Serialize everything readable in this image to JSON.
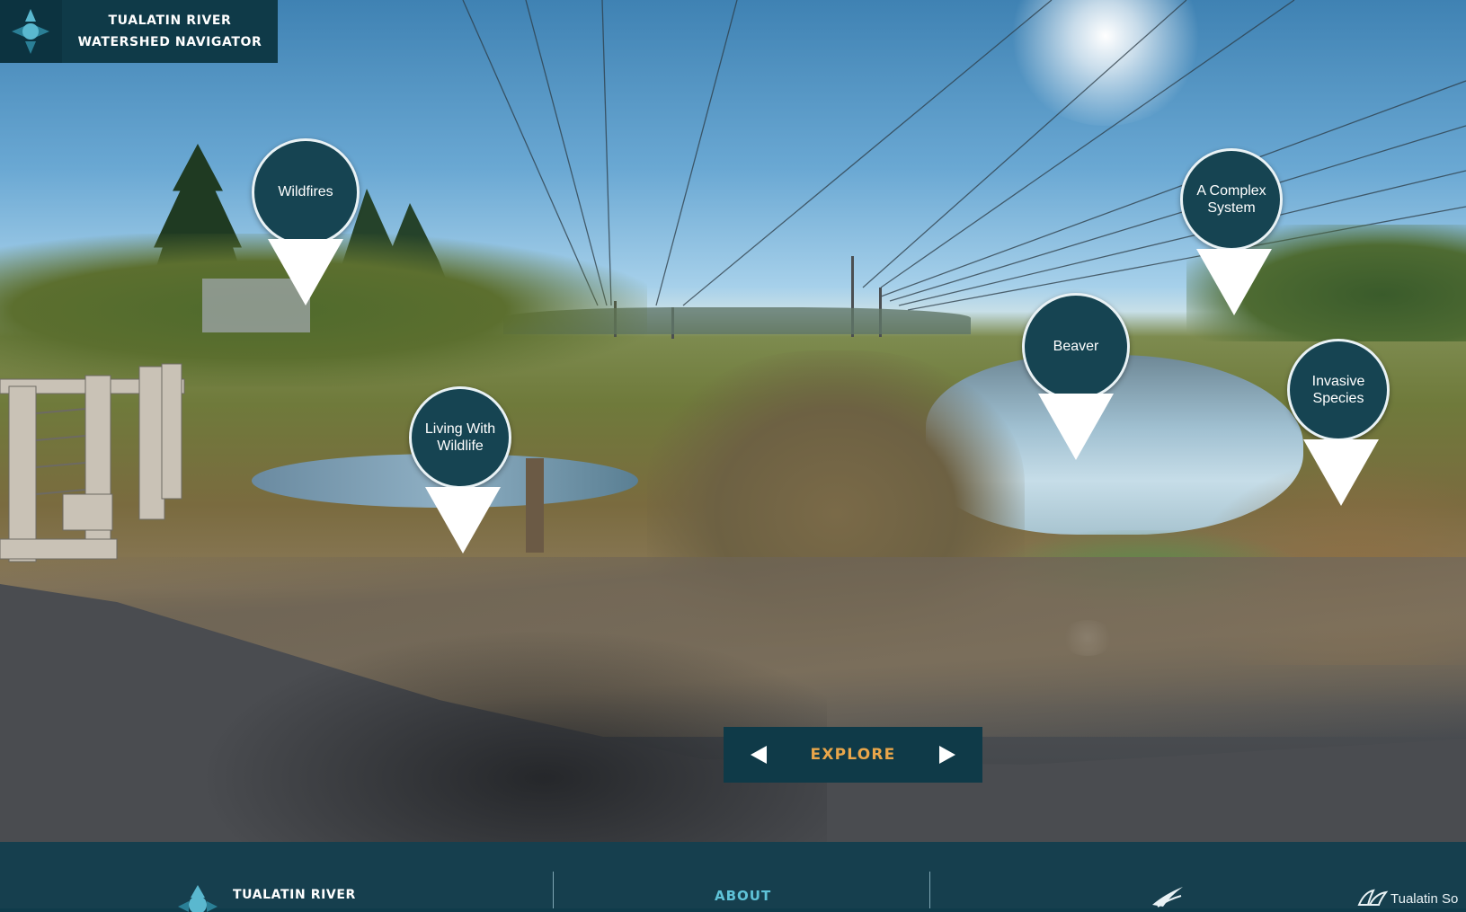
{
  "header": {
    "title_line1": "TUALATIN RIVER",
    "title_line2": "WATERSHED NAVIGATOR",
    "logo_icon": "compass-icon"
  },
  "hotspots": [
    {
      "id": "wildfires",
      "label": "Wildfires"
    },
    {
      "id": "living-with-wildlife",
      "label": "Living With Wildlife"
    },
    {
      "id": "beaver",
      "label": "Beaver"
    },
    {
      "id": "a-complex-system",
      "label": "A Complex System"
    },
    {
      "id": "invasive-species",
      "label": "Invasive Species"
    }
  ],
  "explore": {
    "label": "EXPLORE",
    "prev_icon": "arrow-left-icon",
    "next_icon": "arrow-right-icon"
  },
  "footer": {
    "brand_text": "TUALATIN RIVER",
    "about_label": "ABOUT",
    "partner_text": "Tualatin So"
  },
  "colors": {
    "panel": "#0f3a48",
    "explore_text": "#e9a64a",
    "about_text": "#5fc3d8",
    "hotspot_fill": "#164452"
  }
}
